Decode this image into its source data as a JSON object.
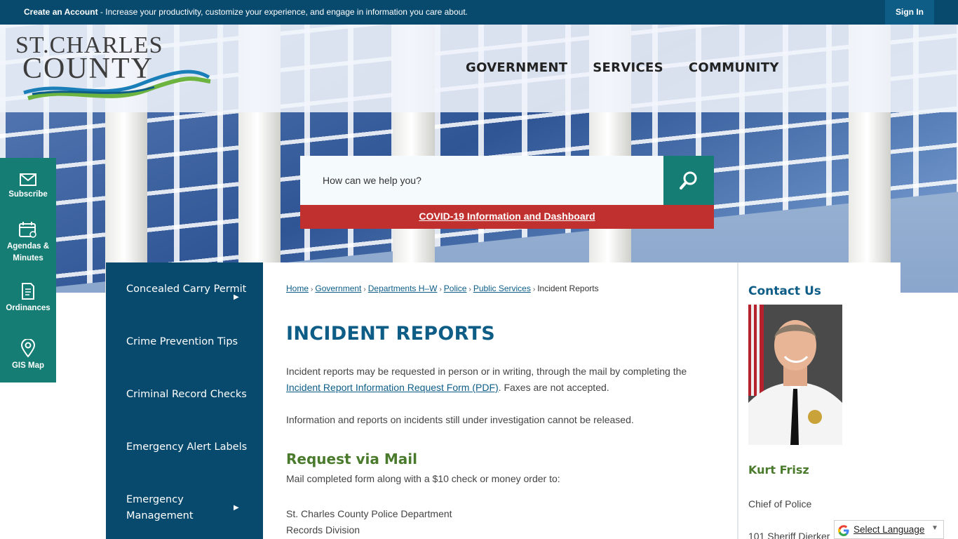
{
  "topbar": {
    "create_account": "Create an Account",
    "message": " - Increase your productivity, customize your experience, and engage in information you care about.",
    "sign_in": "Sign In"
  },
  "logo": {
    "line1": "ST.CHARLES",
    "line2": "COUNTY"
  },
  "main_nav": [
    "GOVERNMENT",
    "SERVICES",
    "COMMUNITY"
  ],
  "search": {
    "placeholder": "How can we help you?",
    "icon": "search-icon"
  },
  "covid_link": "COVID-19 Information and Dashboard",
  "quick_links": [
    {
      "label": "Subscribe",
      "icon": "envelope-icon"
    },
    {
      "label": "Agendas & Minutes",
      "icon": "calendar-icon"
    },
    {
      "label": "Ordinances",
      "icon": "document-icon"
    },
    {
      "label": "GIS Map",
      "icon": "map-pin-icon"
    }
  ],
  "side_nav": [
    {
      "label": "Concealed Carry Permit",
      "has_children": true
    },
    {
      "label": "Crime Prevention Tips",
      "has_children": false
    },
    {
      "label": "Criminal Record Checks",
      "has_children": false
    },
    {
      "label": "Emergency Alert Labels",
      "has_children": false
    },
    {
      "label": "Emergency Management",
      "has_children": true
    }
  ],
  "breadcrumb": {
    "links": [
      "Home",
      "Government",
      "Departments H–W",
      "Police",
      "Public Services"
    ],
    "current": "Incident Reports"
  },
  "page": {
    "title": "INCIDENT REPORTS",
    "intro_before": "Incident reports may be requested in person or in writing, through the mail by completing the ",
    "intro_link": "Incident Report Information Request Form (PDF)",
    "intro_after": ". Faxes are not accepted.",
    "investigation_note": "Information and reports on incidents still under investigation cannot be released.",
    "mail_heading": "Request via Mail",
    "mail_text": "Mail completed form along with a $10 check or money order to:",
    "address_line1": "St. Charles County Police Department",
    "address_line2": "Records Division"
  },
  "contact": {
    "heading": "Contact Us",
    "name": "Kurt Frisz",
    "role": "Chief of Police",
    "street": "101 Sheriff Dierker"
  },
  "translate": {
    "label": "Select Language"
  },
  "colors": {
    "navy": "#074a6e",
    "teal": "#167d74",
    "red": "#c0302f",
    "green": "#4a7a2c",
    "link": "#0d5d87"
  }
}
